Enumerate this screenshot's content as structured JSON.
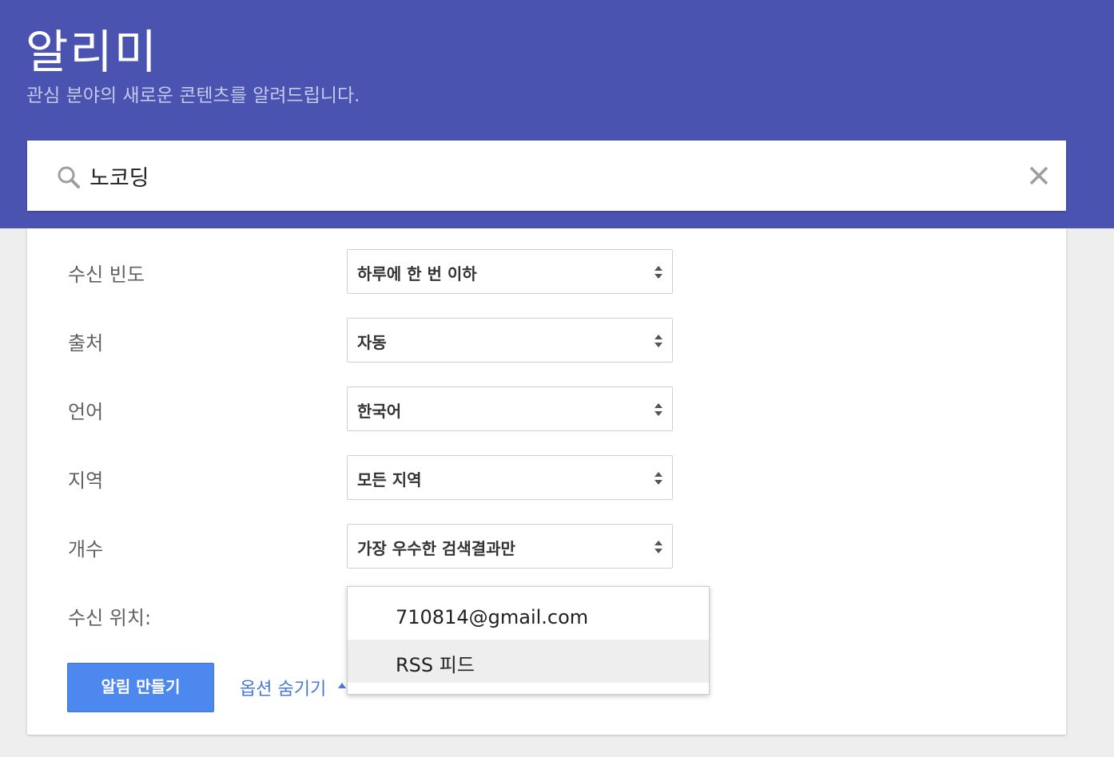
{
  "header": {
    "title": "알리미",
    "subtitle": "관심 분야의 새로운 콘텐츠를 알려드립니다."
  },
  "search": {
    "value": "노코딩"
  },
  "options": [
    {
      "label": "수신 빈도",
      "value": "하루에 한 번 이하"
    },
    {
      "label": "출처",
      "value": "자동"
    },
    {
      "label": "언어",
      "value": "한국어"
    },
    {
      "label": "지역",
      "value": "모든 지역"
    },
    {
      "label": "개수",
      "value": "가장 우수한 검색결과만"
    }
  ],
  "delivery": {
    "label": "수신 위치:",
    "choices": [
      "710814@gmail.com",
      "RSS 피드"
    ],
    "highlighted": "RSS 피드"
  },
  "actions": {
    "create_label": "알림 만들기",
    "hide_options_label": "옵션 숨기기"
  },
  "colors": {
    "header_bg": "#4a54b0",
    "button_bg": "#4d88ef",
    "link": "#4878d8"
  }
}
